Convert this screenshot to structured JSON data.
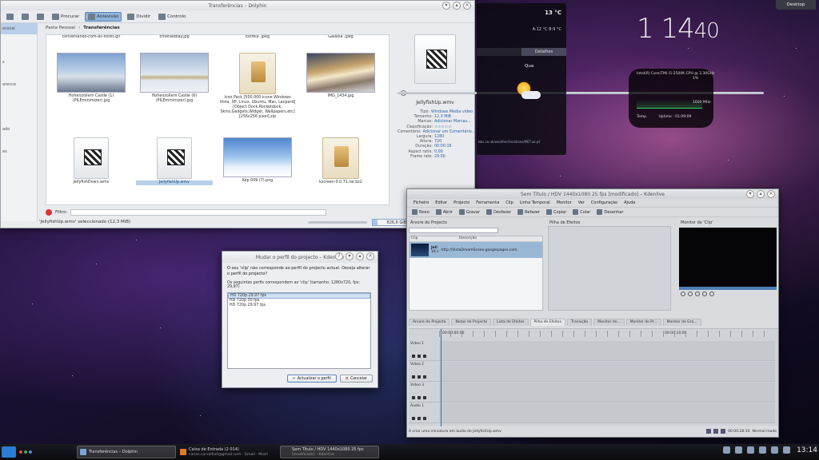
{
  "desktop": {
    "button_label": "Desktop"
  },
  "dolphin": {
    "title": "Transferências – Dolphin",
    "toolbar": {
      "search": "Procurar",
      "preview": "Antevisão",
      "split": "Dividir",
      "control": "Controlo"
    },
    "breadcrumb": {
      "home": "Pasta Pessoal",
      "current": "Transferências"
    },
    "places": [
      "essoal",
      "",
      "",
      "s",
      "",
      "erence",
      "",
      "",
      "",
      "ado",
      "",
      "es"
    ],
    "files": [
      {
        "name": "conversando-com-as-flores.gif",
        "kind": "strip"
      },
      {
        "name": "EmeraldBay.jpg",
        "kind": "strip"
      },
      {
        "name": "Estrela .jpeg",
        "kind": "strip"
      },
      {
        "name": "Galaxia .jpeg",
        "kind": "strip"
      },
      {
        "name": "Hohenzollern Castle (1) (PILEminimizer).jpg",
        "kind": "castle1"
      },
      {
        "name": "Hohenzollern Castle (6) (PILEminimizer).jpg",
        "kind": "castle2"
      },
      {
        "name": "Icon Pack [500.000 icone Windows Vista, XP, Linux, Ubuntu, Mac, Leopard] [Object Dock,Rocketdock, Skins,Gadgets,Widget, Wallpapers,etc] [256x256 pixel].zip",
        "kind": "zip"
      },
      {
        "name": "IMG_1434.jpg",
        "kind": "train"
      },
      {
        "name": "JellyfishDown.wmv",
        "kind": "wmv"
      },
      {
        "name": "JellyfishUp.wmv",
        "kind": "wmv"
      },
      {
        "name": "Kép 009 (7).png",
        "kind": "snow"
      },
      {
        "name": "kscreen-0.0.71.tar.bz2",
        "kind": "zip"
      }
    ],
    "info": {
      "filename": "JellyfishUp.wmv",
      "meta": [
        {
          "k": "Tipo:",
          "v": "Windows Media video"
        },
        {
          "k": "Tamanho:",
          "v": "12,3 MiB"
        },
        {
          "k": "Marcas:",
          "v": "Adicionar Marcas..."
        },
        {
          "k": "Classificação:",
          "v": "☆☆☆☆☆"
        },
        {
          "k": "Comentário:",
          "v": "Adicionar um Comentário..."
        },
        {
          "k": "Largura:",
          "v": "1280"
        },
        {
          "k": "Altura:",
          "v": "720"
        },
        {
          "k": "Duração:",
          "v": "00:00:16"
        },
        {
          "k": "Aspect ratio:",
          "v": "0,00"
        },
        {
          "k": "Frame rate:",
          "v": "29.00"
        }
      ]
    },
    "filter_label": "Filtro:",
    "status_text": "'JellyfishUp.wmv' seleccionado (12,3 MiB)",
    "free_space": "826,6 GiB livre"
  },
  "weather": {
    "temp": "13 °C",
    "minmax": "A:12 °C B:9 °C",
    "tabs": [
      "",
      "Detalhes"
    ],
    "day": "Qua",
    "source": "bbc.co.uk/weather/locations/MET.uk.pt"
  },
  "clock": {
    "hour": "1 14",
    "minute": "40"
  },
  "sysmon": {
    "cpu_name": "Intel(R) Core(TM) i5-2500K CPU @ 3.30GHz",
    "cpu_pct": "1%",
    "freq": "1600 MHz",
    "temp_label": "Temp.",
    "uptime_label": "Uptime :",
    "uptime": "01:09:09"
  },
  "kdenlive": {
    "title": "Sem Título / HDV 1440x1080 25 fps [modificado] – Kdenlive",
    "menu": [
      "Ficheiro",
      "Editar",
      "Projecto",
      "Ferramenta",
      "Clip",
      "Linha Temporal",
      "Monitor",
      "Ver",
      "Configuração",
      "Ajuda"
    ],
    "tools": [
      "Novo",
      "Abrir",
      "Gravar",
      "Desfazer",
      "Refazer",
      "Copiar",
      "Colar",
      "Desenhar"
    ],
    "project_tree_title": "Árvore do Projecto",
    "effect_stack_title": "Pilha de Efeitos",
    "clip_monitor_title": "Monitor de 'Clip'",
    "columns": [
      "Clip",
      "Descrição"
    ],
    "clip_name": "Jell",
    "clip_desc": "http://VistaDreamScene.googlepages.com",
    "clip_dur": "16 s",
    "tabs": [
      "Árvore do Projecto",
      "Notas do Projecto",
      "Lista de Efeitos",
      "Pilha de Efeitos",
      "Transição",
      "Monitor de...",
      "Monitor do Pr...",
      "Monitor de Gra..."
    ],
    "ruler": [
      "00:00:00:00",
      "00:00:10:00"
    ],
    "tracks": [
      "Vídeo 1",
      "Vídeo 2",
      "Vídeo 3",
      "Áudio 1"
    ],
    "status": "A criar uma miniatura em áudio de JellyfishUp.wmv",
    "timecode": "00:00:28:10",
    "zoom": "Normal mode"
  },
  "dialog": {
    "title": "Mudar o perfil do projecto – Kdenlive",
    "message": "O seu 'clip' não corresponde ao perfil do projecto actual. Deseja alterar o perfil do projecto?",
    "list_label": "Os seguintes perfis correspondem ao 'clip' (tamanho: 1280x720, fps: 29,97)",
    "profiles": [
      "HD 720p 29.97 fps",
      "HD 720p 30 fps",
      "HD 720p 29.97 fps"
    ],
    "ok": "Actualizar o perfil",
    "cancel": "Cancelar"
  },
  "taskbar": {
    "tasks": [
      {
        "title": "Transferências – Dolphin",
        "sub": ""
      },
      {
        "title": "Caixa de Entrada (2 014)",
        "sub": "carlos.carvalho0@gmail.com - Gmail - Mozil"
      },
      {
        "title": "Sem Título / HDV 1440x1080 25 fps",
        "sub": "[modificado] – Kdenlive"
      }
    ],
    "clock": "13:14"
  }
}
